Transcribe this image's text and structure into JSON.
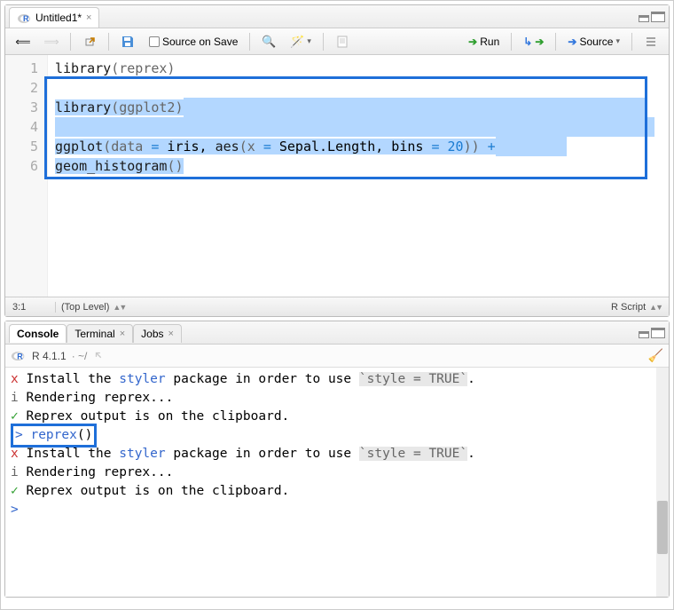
{
  "editor": {
    "tab_title": "Untitled1*",
    "source_on_save": "Source on Save",
    "run_label": "Run",
    "source_label": "Source",
    "lines": [
      "1",
      "2",
      "3",
      "4",
      "5",
      "6"
    ],
    "code": {
      "l1_a": "library",
      "l1_b": "(reprex)",
      "l3_a": "library",
      "l3_b": "(ggplot2)",
      "l5_a": "ggplot",
      "l5_b": "(data ",
      "l5_eq": "=",
      "l5_c": " iris, ",
      "l5_d": "aes",
      "l5_e": "(x ",
      "l5_eq2": "=",
      "l5_f": " Sepal.Length, bins ",
      "l5_eq3": "=",
      "l5_g": " ",
      "l5_num": "20",
      "l5_h": "))",
      "l5_i": " +",
      "l6_a": "  geom_histogram",
      "l6_b": "()"
    },
    "cursor_pos": "3:1",
    "scope": "(Top Level)",
    "lang": "R Script"
  },
  "console": {
    "tabs": [
      "Console",
      "Terminal",
      "Jobs"
    ],
    "version": "R 4.1.1",
    "path": " · ~/",
    "lines": [
      {
        "mark": "x",
        "pre": " Install the ",
        "pkg": "styler",
        "post": " package in order to use ",
        "code": "`style = TRUE`",
        "end": "."
      },
      {
        "mark": "i",
        "text": " Rendering reprex..."
      },
      {
        "mark": "✓",
        "text": " Reprex output is on the clipboard."
      },
      {
        "prompt": ">",
        "call": "reprex",
        "paren": "()",
        "boxed": true
      },
      {
        "mark": "x",
        "pre": " Install the ",
        "pkg": "styler",
        "post": " package in order to use ",
        "code": "`style = TRUE`",
        "end": "."
      },
      {
        "mark": "i",
        "text": " Rendering reprex..."
      },
      {
        "mark": "✓",
        "text": " Reprex output is on the clipboard."
      },
      {
        "prompt": ">",
        "rest": ""
      }
    ]
  },
  "icons": {
    "back": "←",
    "fwd": "→",
    "popout": "↗",
    "save": "💾",
    "search": "🔍",
    "wand": "✨"
  }
}
